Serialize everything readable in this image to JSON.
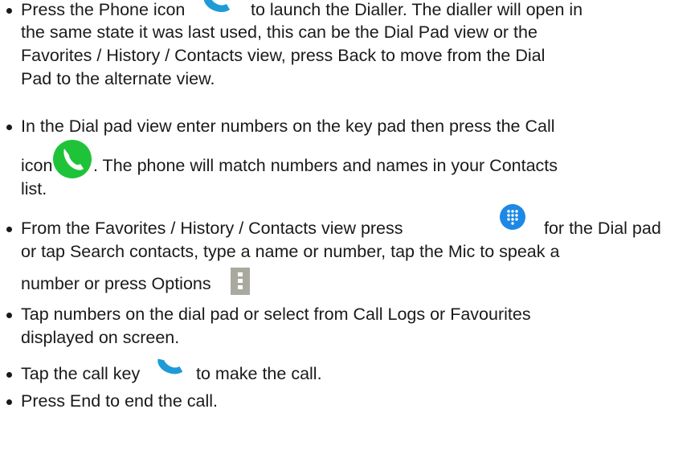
{
  "items": [
    {
      "lines": [
        [
          "Press the Phone icon",
          "to launch the Dialler. The dialler will open in"
        ],
        "the same state it was last used, this can be the Dial Pad view or the",
        "Favorites / History / Contacts view, press Back to move from the Dial",
        "Pad to the alternate view."
      ],
      "icons": [
        "phone-handset-icon"
      ]
    },
    {
      "lines": [
        "In the Dial pad view enter numbers on the key pad then press the Call",
        [
          "icon",
          ". The phone will match numbers and names in your Contacts"
        ],
        "list."
      ],
      "icons": [
        "call-button-icon"
      ]
    },
    {
      "lines": [
        [
          "From the Favorites / History / Contacts view press",
          "for the Dial pad"
        ],
        "or tap Search contacts, type a name or number, tap the Mic to speak a",
        "number or press Options"
      ],
      "icons": [
        "dialpad-button-icon",
        "options-menu-icon"
      ]
    },
    {
      "lines": [
        "Tap numbers on the dial pad or select from Call Logs or Favourites",
        "displayed on screen."
      ],
      "icons": []
    },
    {
      "lines": [
        [
          "Tap the call key",
          "to make the call."
        ]
      ],
      "icons": [
        "phone-handset-icon"
      ]
    },
    {
      "lines": [
        "Press End to end the call."
      ],
      "icons": []
    }
  ],
  "colors": {
    "text": "#1a1a1a",
    "phone_blue": "#1e9bd7",
    "call_green": "#1fc339",
    "dialpad_blue": "#1e88e5",
    "options_gray": "#a9a9a0"
  }
}
